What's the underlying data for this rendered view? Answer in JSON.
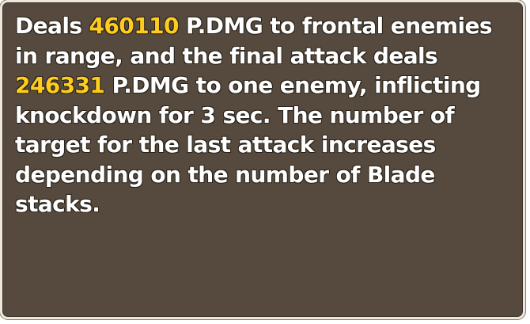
{
  "tooltip": {
    "text_1": "Deals ",
    "damage_1": "460110",
    "text_2": " P.DMG to frontal enemies in range, and the final attack deals ",
    "damage_2": "246331",
    "text_3": " P.DMG to one enemy, inflicting knockdown for 3 sec. The number of target for the last attack increases depending on the number of Blade stacks.",
    "colors": {
      "background": "#554a3d",
      "border": "#efe7db",
      "text": "#ffffff",
      "damage_highlight": "#ffcc1e"
    }
  }
}
